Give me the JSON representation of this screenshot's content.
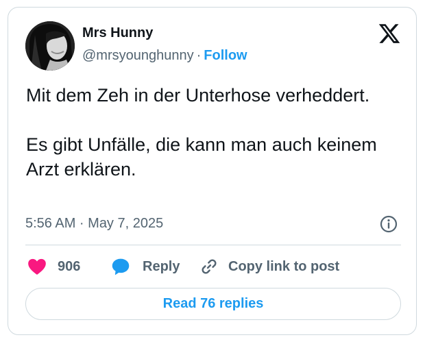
{
  "author": {
    "name": "Mrs Hunny",
    "handle": "@mrsyounghunny",
    "separator": "·",
    "follow_label": "Follow"
  },
  "tweet": {
    "paragraphs": [
      "Mit dem Zeh in der Unterhose verheddert.",
      "Es gibt Unfälle, die kann man auch keinem Arzt erklären."
    ],
    "timestamp": "5:56 AM · May 7, 2025"
  },
  "actions": {
    "like_count": "906",
    "reply_label": "Reply",
    "copy_label": "Copy link to post"
  },
  "footer": {
    "read_replies_label": "Read 76 replies"
  },
  "colors": {
    "accent": "#1d9bf0",
    "like": "#f91880",
    "text": "#0f1419",
    "secondary_text": "#536471",
    "border": "#cfd9de"
  },
  "icons": {
    "brand": "x-logo-icon",
    "info": "info-icon",
    "like": "heart-icon",
    "reply": "speech-bubble-icon",
    "copy": "link-icon"
  }
}
